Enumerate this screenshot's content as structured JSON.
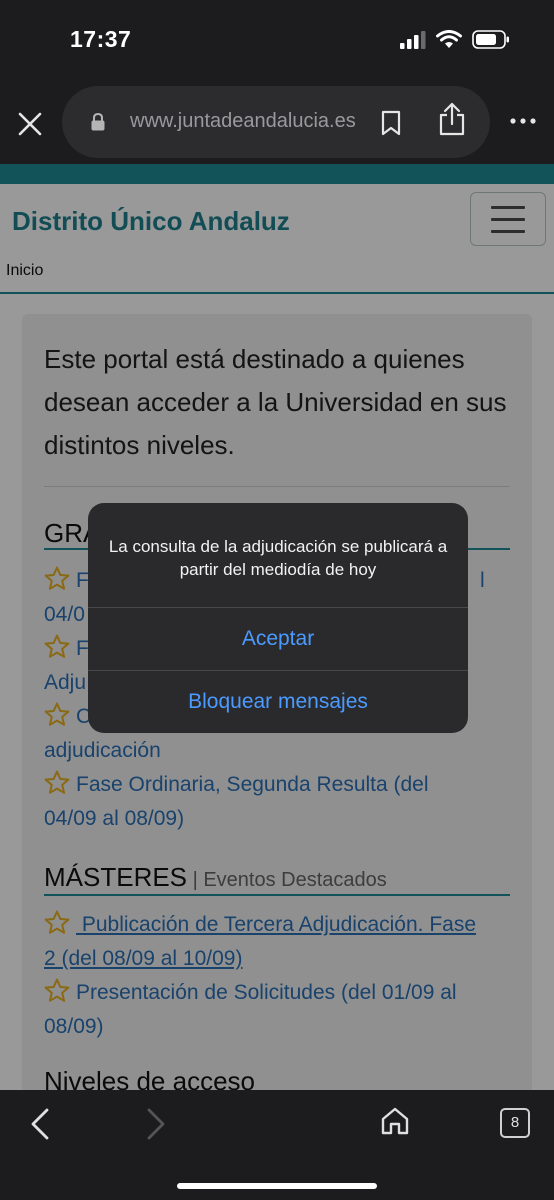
{
  "status": {
    "time": "17:37"
  },
  "browser": {
    "url": "www.juntadeandalucia.es"
  },
  "site": {
    "title": "Distrito Único Andaluz",
    "breadcrumb": "Inicio"
  },
  "content": {
    "intro": "Este portal está destinado a quienes desean acceder a la Universidad en sus distintos niveles.",
    "grado": {
      "heading": "GRA",
      "links": [
        {
          "text": "F",
          "text2": "l"
        },
        {
          "text": "04/0"
        },
        {
          "text": "F"
        },
        {
          "text": "Adju"
        },
        {
          "text": "C"
        },
        {
          "text": "adjudicación"
        },
        {
          "text": "Fase Ordinaria, Segunda Resulta (del",
          "text2": "04/09 al 08/09)"
        }
      ]
    },
    "masters": {
      "heading": "MÁSTERES",
      "subheading": " | Eventos Destacados",
      "links": [
        {
          "line1": " Publicación de Tercera Adjudicación. Fase",
          "line2": "2 (del 08/09 al 10/09)"
        },
        {
          "line1": "Presentación de Solicitudes (del 01/09 al",
          "line2": "08/09)"
        }
      ]
    },
    "niveles": {
      "heading": "Niveles de acceso"
    }
  },
  "alert": {
    "message": "La consulta de la adjudicación se publicará a partir del mediodía de hoy",
    "accept_label": "Aceptar",
    "block_label": "Bloquear mensajes"
  },
  "toolbar": {
    "tab_count": "8"
  },
  "colors": {
    "teal": "#1e8a96",
    "link_blue": "#2a6fb6",
    "alert_button_blue": "#4b9bff",
    "star_gold": "#e8b021"
  }
}
